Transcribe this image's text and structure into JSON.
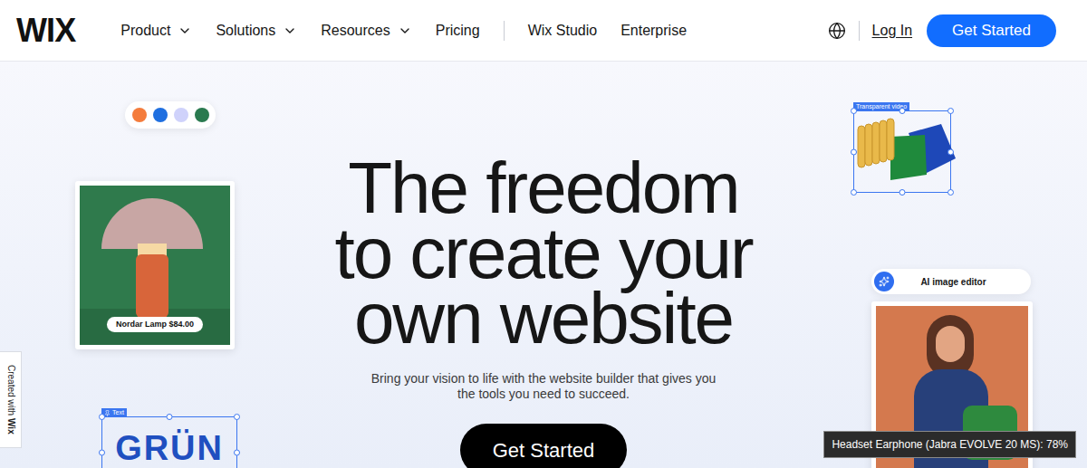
{
  "nav": {
    "logo": "WIX",
    "main": [
      {
        "label": "Product",
        "dropdown": true
      },
      {
        "label": "Solutions",
        "dropdown": true
      },
      {
        "label": "Resources",
        "dropdown": true
      },
      {
        "label": "Pricing",
        "dropdown": false
      }
    ],
    "secondary": [
      {
        "label": "Wix Studio"
      },
      {
        "label": "Enterprise"
      }
    ],
    "login": "Log In",
    "cta": "Get Started"
  },
  "hero": {
    "headline": [
      "The freedom",
      "to create your",
      "own website"
    ],
    "subtext": [
      "Bring your vision to life with the website builder that gives you",
      "the tools you need to succeed."
    ],
    "cta": "Get Started"
  },
  "swatches": [
    {
      "color": "#f47c3c"
    },
    {
      "color": "#1f6fe0"
    },
    {
      "color": "#cfd2fb"
    },
    {
      "color": "#2a7a4f"
    }
  ],
  "product_card": {
    "label": "Nordar Lamp $84.00"
  },
  "video_element": {
    "label": "Transparent video"
  },
  "text_element": {
    "label": "Text",
    "text": "GRÜN"
  },
  "ai_card": {
    "label": "AI image editor"
  },
  "side_tab": {
    "prefix": "Created with",
    "brand": "Wix"
  },
  "tooltip": {
    "text": "Headset Earphone (Jabra EVOLVE 20 MS): 78%"
  }
}
